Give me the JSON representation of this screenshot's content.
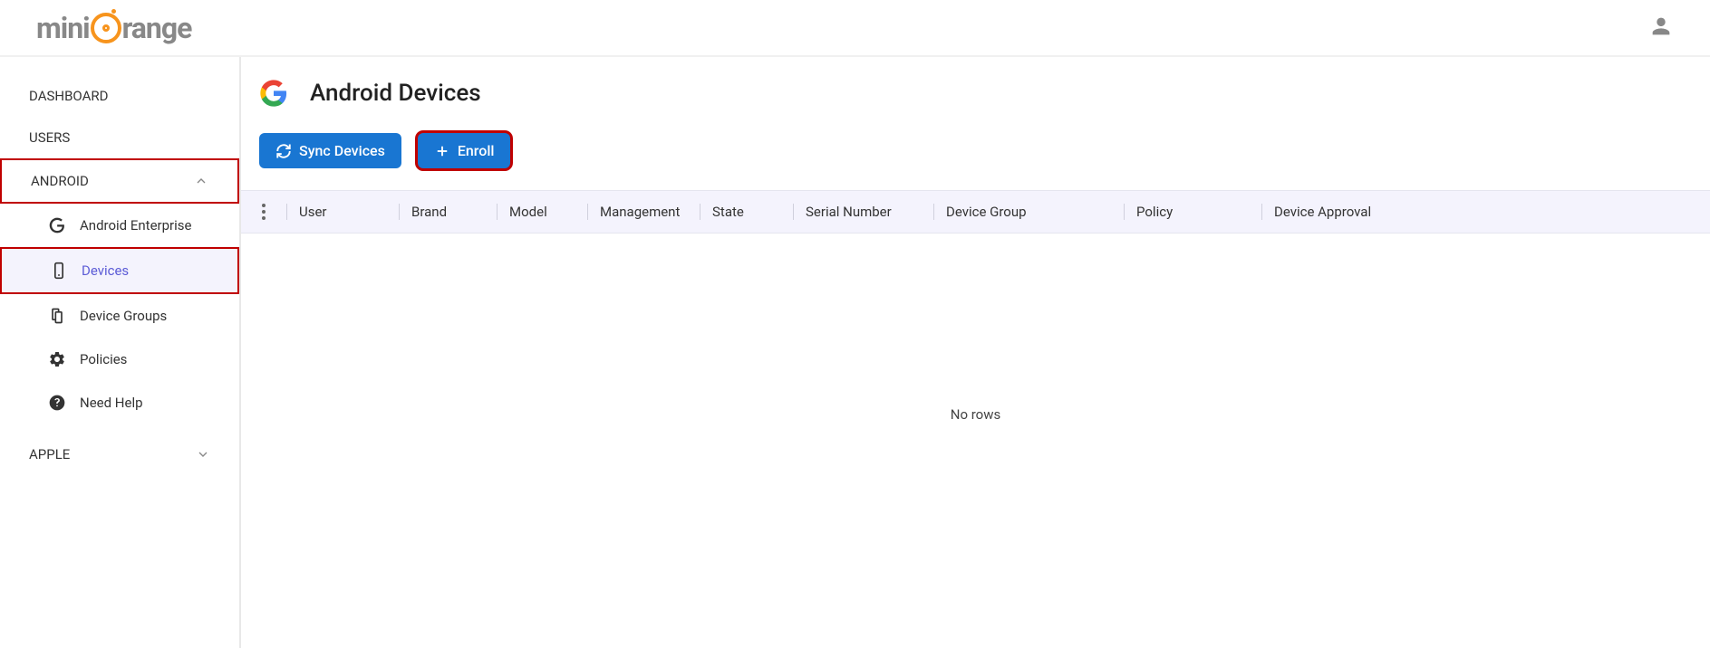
{
  "brand": {
    "name_prefix": "mini",
    "name_suffix": "range"
  },
  "sidebar": {
    "dashboard": "DASHBOARD",
    "users": "USERS",
    "android": "ANDROID",
    "apple": "APPLE",
    "android_items": {
      "enterprise": "Android Enterprise",
      "devices": "Devices",
      "device_groups": "Device Groups",
      "policies": "Policies",
      "need_help": "Need Help"
    }
  },
  "page": {
    "title": "Android Devices"
  },
  "toolbar": {
    "sync": "Sync Devices",
    "enroll": "Enroll"
  },
  "table": {
    "columns": {
      "user": "User",
      "brand": "Brand",
      "model": "Model",
      "management": "Management",
      "state": "State",
      "serial": "Serial Number",
      "group": "Device Group",
      "policy": "Policy",
      "approval": "Device Approval"
    },
    "empty": "No rows",
    "rows": []
  }
}
